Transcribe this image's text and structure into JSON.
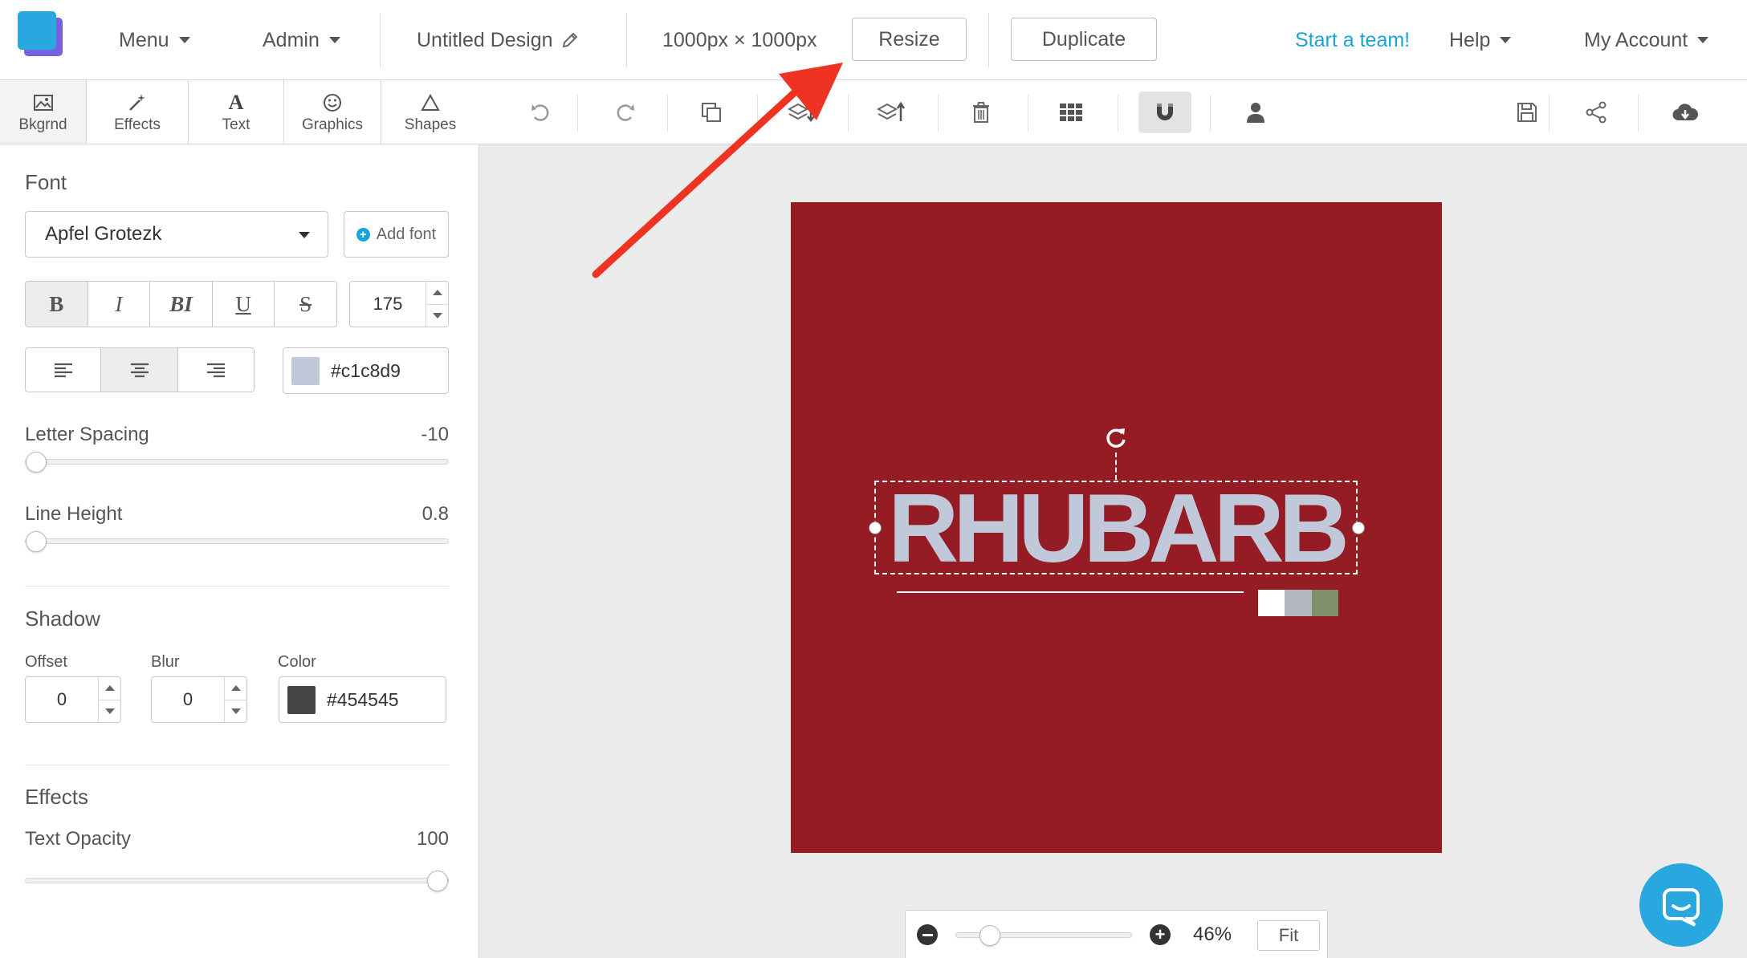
{
  "topbar": {
    "menu_label": "Menu",
    "admin_label": "Admin",
    "design_title": "Untitled Design",
    "dimensions": "1000px × 1000px",
    "resize_label": "Resize",
    "duplicate_label": "Duplicate",
    "team_link": "Start a team!",
    "help_label": "Help",
    "account_label": "My Account"
  },
  "tabs": [
    {
      "label": "Bkgrnd",
      "icon": "image-icon"
    },
    {
      "label": "Effects",
      "icon": "magic-wand-icon"
    },
    {
      "label": "Text",
      "icon": "text-icon"
    },
    {
      "label": "Graphics",
      "icon": "smiley-icon"
    },
    {
      "label": "Shapes",
      "icon": "triangle-icon"
    }
  ],
  "toolbar": {
    "icons": [
      "undo-icon",
      "redo-icon",
      "copy-icon",
      "layer-down-icon",
      "layer-up-icon",
      "trash-icon",
      "grid-icon",
      "magnet-icon",
      "user-icon",
      "save-icon",
      "share-icon",
      "cloud-download-icon"
    ],
    "active_tool": "magnet-icon"
  },
  "sidebar": {
    "font_title": "Font",
    "font_name": "Apfel Grotezk",
    "add_font_label": "Add font",
    "style_buttons": [
      "B",
      "I",
      "BI",
      "U",
      "S"
    ],
    "font_size": "175",
    "text_color": "#c1c8d9",
    "letter_spacing_label": "Letter Spacing",
    "letter_spacing_value": "-10",
    "letter_spacing_fraction": 0.0,
    "line_height_label": "Line Height",
    "line_height_value": "0.8",
    "line_height_fraction": 0.0,
    "shadow_title": "Shadow",
    "offset_label": "Offset",
    "offset_value": "0",
    "blur_label": "Blur",
    "blur_value": "0",
    "color_label": "Color",
    "shadow_color": "#454545",
    "effects_title": "Effects",
    "opacity_label": "Text Opacity",
    "opacity_value": "100",
    "opacity_fraction": 1.0
  },
  "canvas": {
    "background_color": "#951c24",
    "text": "RHUBARB",
    "palette": [
      "#ffffff",
      "#b4b7bd",
      "#7f906b"
    ]
  },
  "zoom": {
    "percent": "46%",
    "fit_label": "Fit",
    "fraction": 0.15
  },
  "colors": {
    "accent": "#1aa3d9",
    "chat": "#29a8e0",
    "arrow": "#ee3322"
  }
}
